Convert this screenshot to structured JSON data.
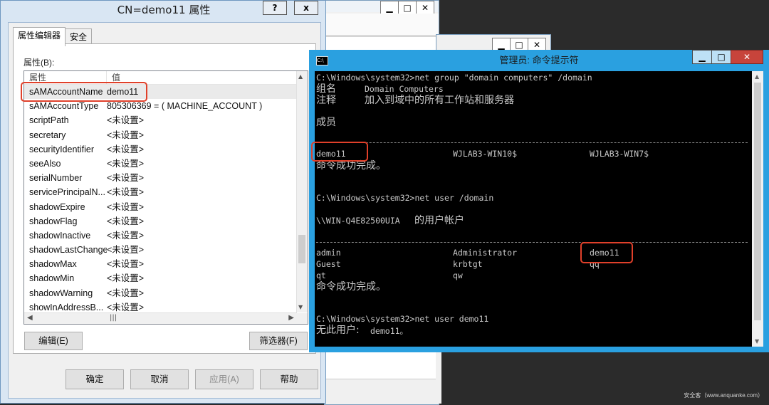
{
  "properties_dialog": {
    "title": "CN=demo11 属性",
    "help_btn": "?",
    "close_btn": "x",
    "tabs": [
      "属性编辑器",
      "安全"
    ],
    "list_label": "属性(B):",
    "columns": [
      "属性",
      "值"
    ],
    "rows": [
      {
        "attr": "sAMAccountName",
        "value": "demo11"
      },
      {
        "attr": "sAMAccountType",
        "value": "805306369 = ( MACHINE_ACCOUNT )"
      },
      {
        "attr": "scriptPath",
        "value": "<未设置>"
      },
      {
        "attr": "secretary",
        "value": "<未设置>"
      },
      {
        "attr": "securityIdentifier",
        "value": "<未设置>"
      },
      {
        "attr": "seeAlso",
        "value": "<未设置>"
      },
      {
        "attr": "serialNumber",
        "value": "<未设置>"
      },
      {
        "attr": "servicePrincipalN...",
        "value": "<未设置>"
      },
      {
        "attr": "shadowExpire",
        "value": "<未设置>"
      },
      {
        "attr": "shadowFlag",
        "value": "<未设置>"
      },
      {
        "attr": "shadowInactive",
        "value": "<未设置>"
      },
      {
        "attr": "shadowLastChange",
        "value": "<未设置>"
      },
      {
        "attr": "shadowMax",
        "value": "<未设置>"
      },
      {
        "attr": "shadowMin",
        "value": "<未设置>"
      },
      {
        "attr": "shadowWarning",
        "value": "<未设置>"
      },
      {
        "attr": "showInAddressB...",
        "value": "<未设置>"
      }
    ],
    "edit_button": "编辑(E)",
    "filter_button": "筛选器(F)",
    "ok_button": "确定",
    "cancel_button": "取消",
    "apply_button": "应用(A)",
    "help_button": "帮助"
  },
  "cmd_window": {
    "title": "管理员: 命令提示符",
    "lines": {
      "l1": "C:\\Windows\\system32>net group \"domain computers\" /domain",
      "l2a": "组名",
      "l2b": "Domain Computers",
      "l3a": "注释",
      "l3b": "加入到域中的所有工作站和服务器",
      "l4": "成员",
      "m1": "demo11",
      "m2": "WJLAB3-WIN10$",
      "m3": "WJLAB3-WIN7$",
      "ok1": "命令成功完成。",
      "l5": "C:\\Windows\\system32>net user /domain",
      "l6a": "\\\\WIN-Q4E82500UIA",
      "l6b": "的用户帐户",
      "u1": "admin",
      "u2": "Administrator",
      "u3": "demo11",
      "u4": "Guest",
      "u5": "krbtgt",
      "u6": "qq",
      "u7": "qt",
      "u8": "qw",
      "ok2": "命令成功完成。",
      "l7": "C:\\Windows\\system32>net user demo11",
      "l8a": "无此用户:",
      "l8b": "demo11。"
    }
  },
  "watermark": "安全客（www.anquanke.com）",
  "colors": {
    "highlight": "#e0402a",
    "cmd_border": "#2aa0e0",
    "console_bg": "#000000"
  }
}
